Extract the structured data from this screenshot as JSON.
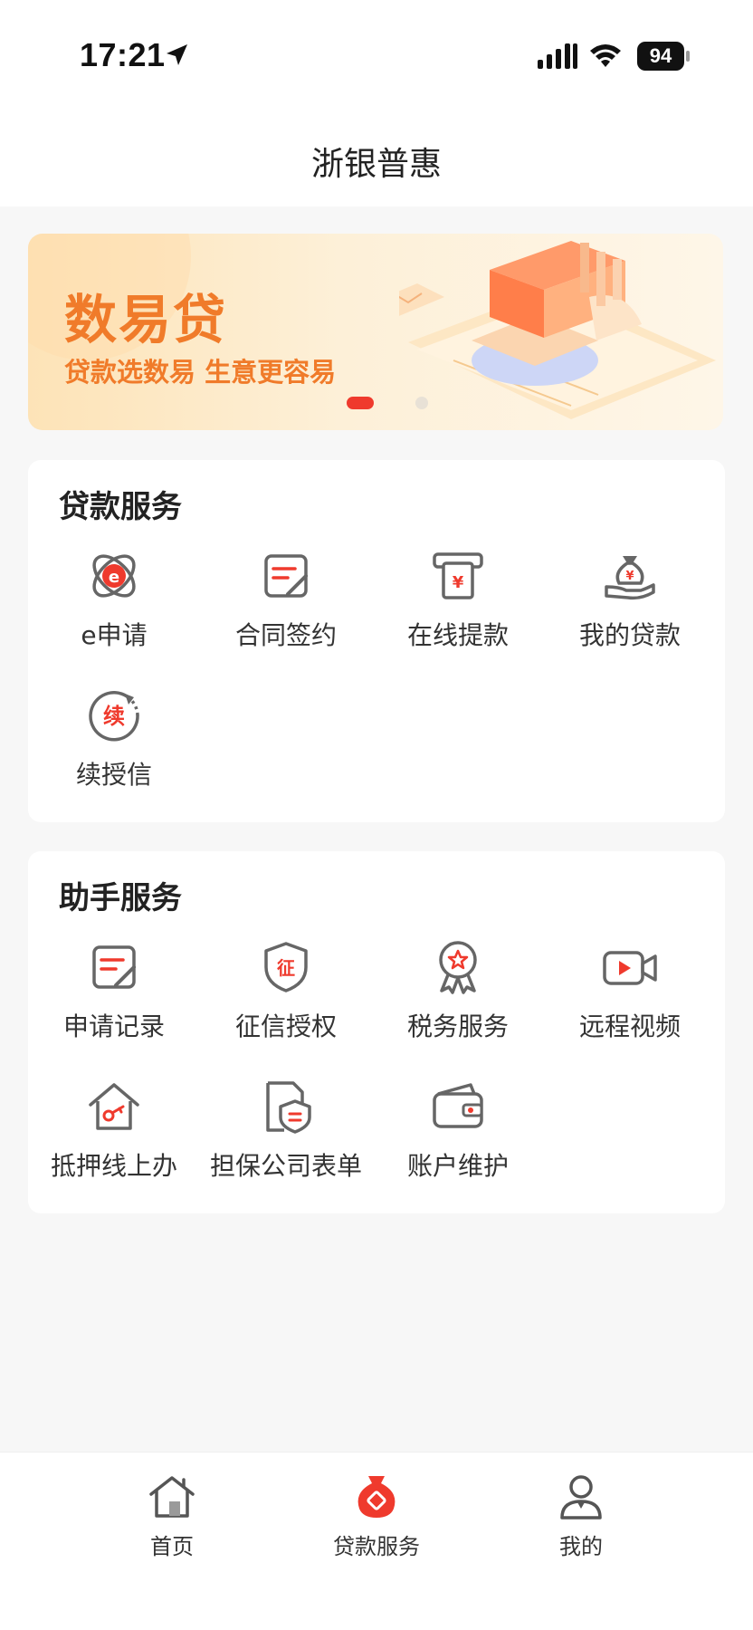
{
  "status_bar": {
    "time": "17:21",
    "battery": "94",
    "icons": [
      "location-arrow-icon",
      "signal-icon",
      "wifi-icon",
      "battery-icon"
    ]
  },
  "nav": {
    "title": "浙银普惠"
  },
  "banner": {
    "title": "数易贷",
    "subtitle": "贷款选数易 生意更容易",
    "pages_total": 2,
    "active_page": 1
  },
  "loan_services": {
    "title": "贷款服务",
    "items": [
      {
        "label": "e申请",
        "icon": "e-apply-icon"
      },
      {
        "label": "合同签约",
        "icon": "contract-sign-icon"
      },
      {
        "label": "在线提款",
        "icon": "atm-withdraw-icon"
      },
      {
        "label": "我的贷款",
        "icon": "money-bag-hand-icon"
      },
      {
        "label": "续授信",
        "icon": "renew-credit-icon"
      }
    ]
  },
  "assistant_services": {
    "title": "助手服务",
    "items": [
      {
        "label": "申请记录",
        "icon": "record-icon"
      },
      {
        "label": "征信授权",
        "icon": "credit-shield-icon"
      },
      {
        "label": "税务服务",
        "icon": "tax-badge-icon"
      },
      {
        "label": "远程视频",
        "icon": "video-camera-icon"
      },
      {
        "label": "抵押线上办",
        "icon": "house-key-icon"
      },
      {
        "label": "担保公司表单",
        "icon": "guarantee-form-icon"
      },
      {
        "label": "账户维护",
        "icon": "wallet-icon"
      }
    ]
  },
  "tab_bar": {
    "tabs": [
      {
        "label": "首页",
        "icon": "home-icon",
        "active": false
      },
      {
        "label": "贷款服务",
        "icon": "loan-bag-icon",
        "active": true
      },
      {
        "label": "我的",
        "icon": "user-icon",
        "active": false
      }
    ]
  },
  "colors": {
    "accent_red": "#ef3a2d",
    "banner_orange": "#f07b2a",
    "icon_gray": "#666666",
    "page_bg": "#f7f7f7"
  }
}
